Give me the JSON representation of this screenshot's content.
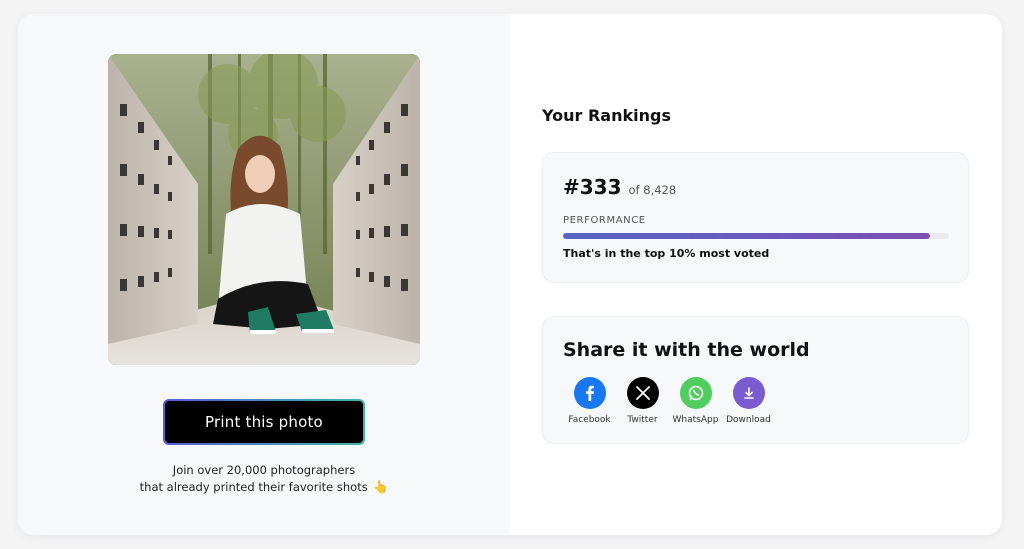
{
  "photo": {
    "description_icon": "photo-of-girl-on-bridge"
  },
  "print": {
    "button_label": "Print this photo",
    "join_line1": "Join over 20,000 photographers",
    "join_line2": "that already printed their favorite shots",
    "hand_emoji": "👆"
  },
  "rankings": {
    "title": "Your Rankings",
    "rank": "#333",
    "of_total": "of 8,428",
    "performance_label": "PERFORMANCE",
    "performance_fraction": 0.95,
    "top_text": "That's in the top 10% most voted"
  },
  "share": {
    "title": "Share it with the world",
    "items": [
      {
        "label": "Facebook",
        "icon": "facebook-icon",
        "color": "#1877f2"
      },
      {
        "label": "Twitter",
        "icon": "x-icon",
        "color": "#000000"
      },
      {
        "label": "WhatsApp",
        "icon": "whatsapp-icon",
        "color": "#4fce5d"
      },
      {
        "label": "Download",
        "icon": "download-icon",
        "color": "#7a5bd0"
      }
    ]
  },
  "colors": {
    "bar_start": "#5865c8",
    "bar_end": "#7b4fb3",
    "panel_bg": "#f7f8fa"
  }
}
